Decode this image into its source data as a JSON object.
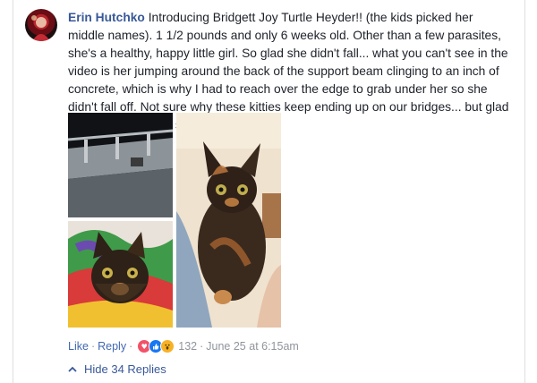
{
  "comment": {
    "author": "Erin Hutchko",
    "text": "Introducing Bridgett Joy Turtle Heyder!! (the kids picked her middle names). 1 1/2 pounds and only 6 weeks old. Other than a few parasites, she's a healthy, happy little girl. So glad she didn't fall... what you can't see in the video is her jumping around the back of the support beam clinging to an inch of concrete, which is why I had to reach over the edge to grab under her so she didn't fall off. Not sure why these kitties keep ending up on our bridges... but glad they've been found safe!"
  },
  "photos": [
    {
      "name": "bridge-beam-photo"
    },
    {
      "name": "kitten-on-blanket-photo"
    },
    {
      "name": "kitten-held-photo"
    }
  ],
  "actions": {
    "like": "Like",
    "dot1": "·",
    "reply": "Reply",
    "dot2": "·",
    "reaction_count": "132",
    "dot3": "·",
    "timestamp": "June 25 at 6:15am"
  },
  "reactions": [
    {
      "name": "love-reaction-icon",
      "color": "#f25268",
      "glyph": "♥"
    },
    {
      "name": "like-reaction-icon",
      "color": "#1877f2",
      "glyph": "👍"
    },
    {
      "name": "wow-reaction-icon",
      "color": "#f7b125",
      "glyph": "😮"
    }
  ],
  "replies": {
    "label": "Hide 34 Replies"
  },
  "colors": {
    "link": "#385898",
    "meta": "#90949c",
    "text": "#1d2129"
  }
}
